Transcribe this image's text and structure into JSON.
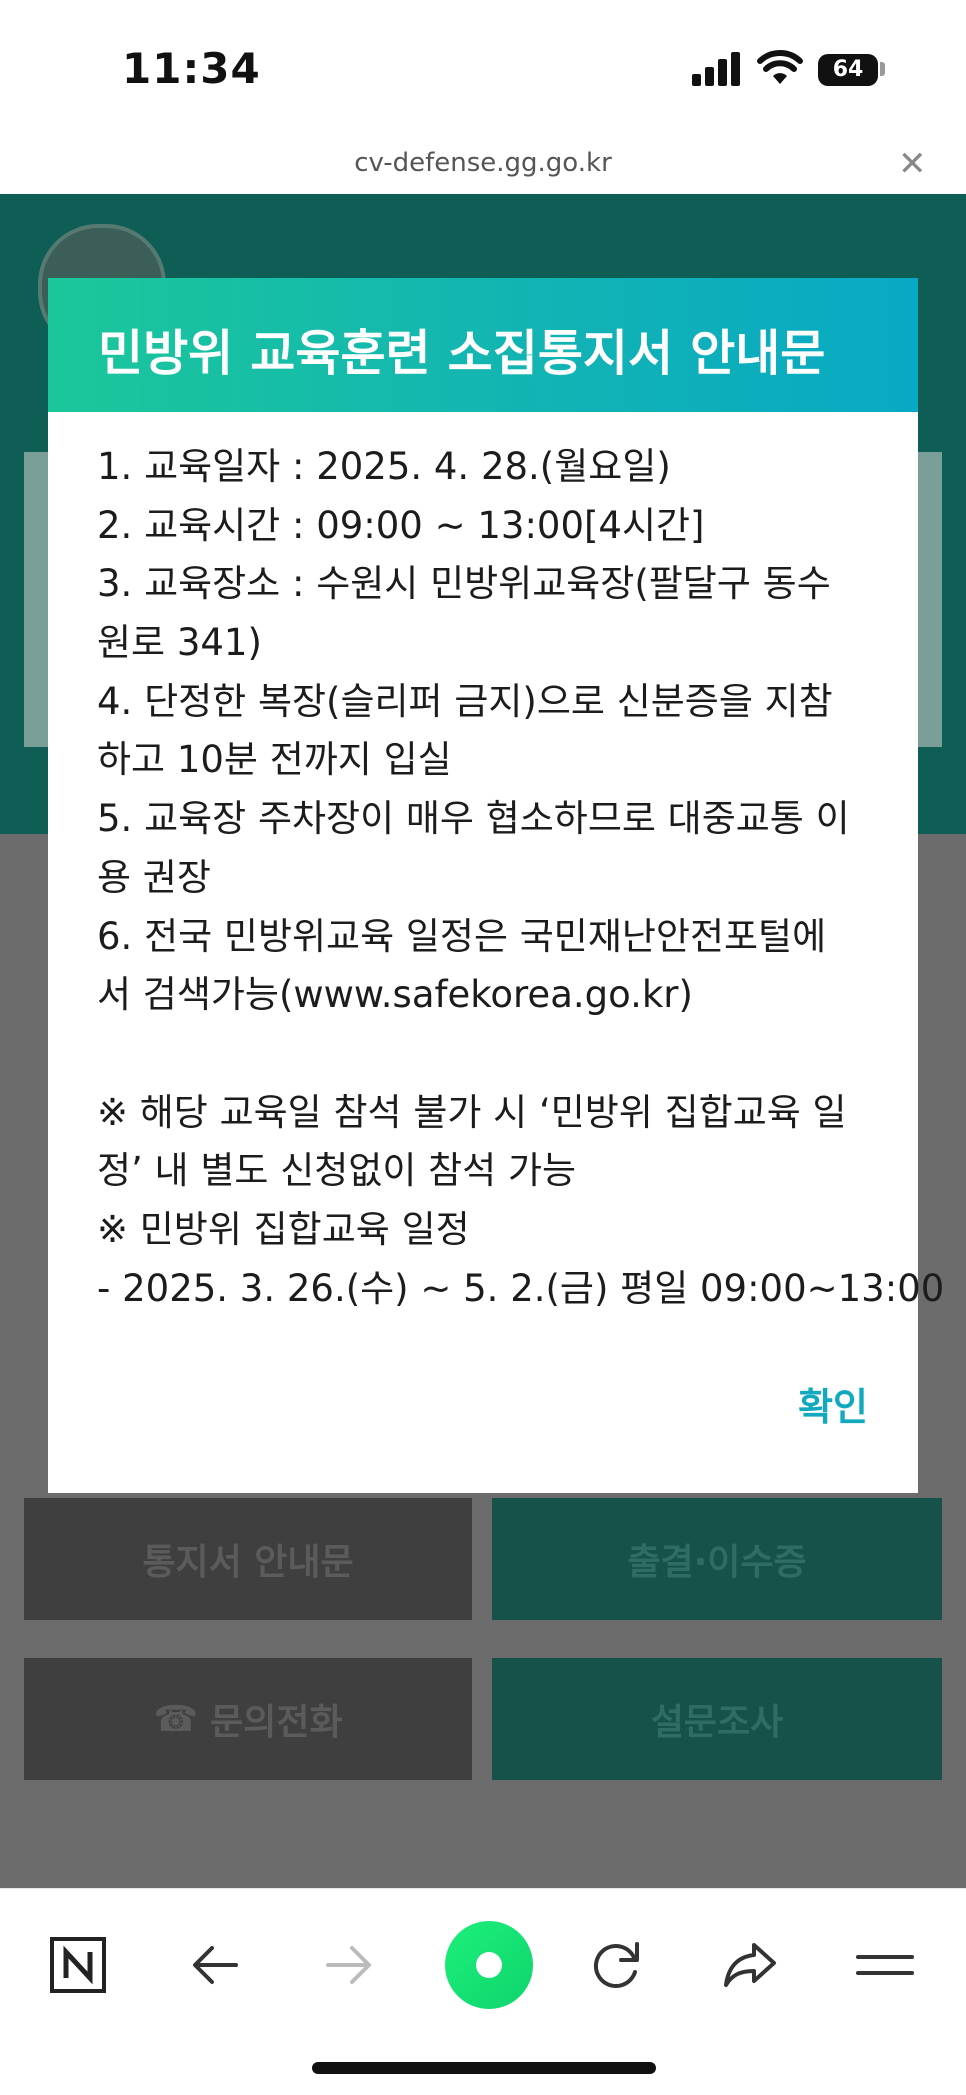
{
  "status_bar": {
    "time": "11:34",
    "battery": "64"
  },
  "browser": {
    "url": "cv-defense.gg.go.kr"
  },
  "background_page": {
    "buttons": [
      {
        "label": "통지서 안내문"
      },
      {
        "label": "출결·이수증"
      },
      {
        "label": "문의전화"
      },
      {
        "label": "설문조사"
      }
    ]
  },
  "modal": {
    "title": "민방위 교육훈련 소집통지서 안내문",
    "lines": [
      "1. 교육일자 : 2025. 4. 28.(월요일)",
      "2. 교육시간 : 09:00 ~ 13:00[4시간]",
      "3. 교육장소 : 수원시 민방위교육장(팔달구 동수",
      "원로 341)",
      "4. 단정한 복장(슬리퍼 금지)으로 신분증을 지참",
      "하고 10분 전까지 입실",
      "5. 교육장 주차장이 매우 협소하므로 대중교통 이",
      "용 권장",
      "6. 전국 민방위교육 일정은 국민재난안전포털에",
      "서 검색가능(www.safekorea.go.kr)",
      "",
      "※ 해당 교육일 참석 불가 시 ‘민방위 집합교육 일",
      "정’ 내 별도 신청없이 참석 가능",
      "※ 민방위 집합교육 일정",
      "- 2025. 3. 26.(수) ~ 5. 2.(금) 평일 09:00~13:00"
    ],
    "confirm_label": "확인"
  },
  "toolbar": {
    "items": [
      "naver-icon",
      "back-icon",
      "forward-icon",
      "green-dot-icon",
      "refresh-icon",
      "share-icon",
      "menu-icon"
    ]
  },
  "colors": {
    "header_gradient_start": "#1bc79a",
    "header_gradient_end": "#08a9c4",
    "confirm": "#12a9be",
    "green_button": "#19e07a"
  }
}
